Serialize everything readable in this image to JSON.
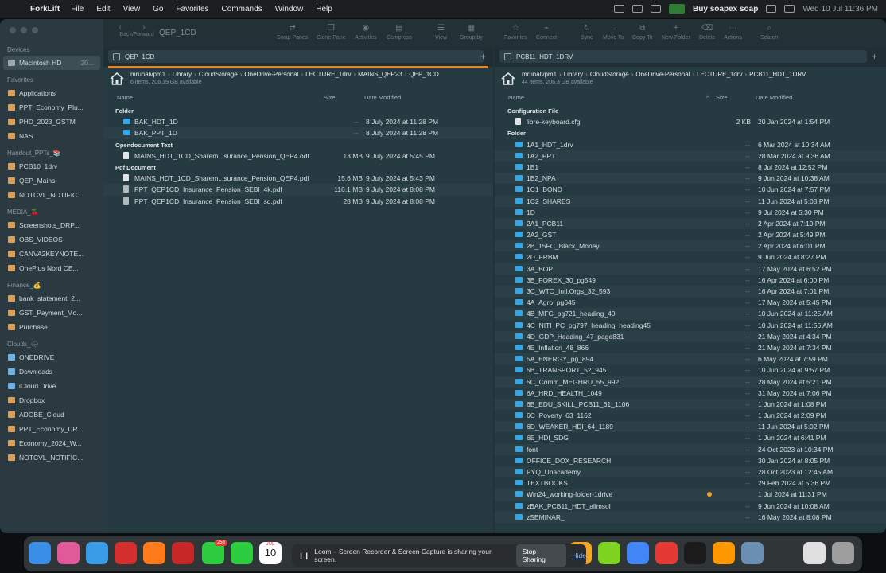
{
  "menubar": {
    "app_name": "ForkLift",
    "items": [
      "File",
      "Edit",
      "View",
      "Go",
      "Favorites",
      "Commands",
      "Window",
      "Help"
    ],
    "notification": "Buy soapex soap",
    "clock": "Wed 10 Jul  11:36 PM"
  },
  "toolbar": {
    "nav_label": "Back/Forward",
    "title": "QEP_1CD",
    "buttons": [
      "Swap Panes",
      "Clone Pane",
      "Activities",
      "Compress",
      "View",
      "Group by",
      "Favorites",
      "Connect",
      "Sync",
      "Move To",
      "Copy To",
      "New Folder",
      "Delete",
      "Actions",
      "Search"
    ]
  },
  "sidebar": {
    "sections": [
      {
        "title": "Devices",
        "items": [
          {
            "label": "Macintosh HD",
            "extra": "20...",
            "icon": "hard-drive-icon",
            "selected": true
          }
        ]
      },
      {
        "title": "Favorites",
        "items": [
          {
            "label": "Applications",
            "icon": "applications-icon"
          },
          {
            "label": "PPT_Economy_Plu...",
            "icon": "folder-icon"
          },
          {
            "label": "PHD_2023_GSTM",
            "icon": "folder-icon"
          },
          {
            "label": "NAS",
            "icon": "folder-icon"
          }
        ]
      },
      {
        "title": "Handout_PPTs_📚",
        "items": [
          {
            "label": "PCB10_1drv",
            "icon": "folder-icon"
          },
          {
            "label": "QEP_Mains",
            "icon": "folder-icon"
          },
          {
            "label": "NOTCVL_NOTIFIC...",
            "icon": "folder-icon"
          }
        ]
      },
      {
        "title": "MEDIA_🍒",
        "items": [
          {
            "label": "Screenshots_DRP...",
            "icon": "folder-icon"
          },
          {
            "label": "OBS_VIDEOS",
            "icon": "folder-icon"
          },
          {
            "label": "CANVA2KEYNOTE...",
            "icon": "folder-icon"
          },
          {
            "label": "OnePlus Nord CE...",
            "icon": "folder-icon"
          }
        ]
      },
      {
        "title": "Finance_💰",
        "items": [
          {
            "label": "bank_statement_2...",
            "icon": "folder-icon"
          },
          {
            "label": "GST_Payment_Mo...",
            "icon": "folder-icon"
          },
          {
            "label": "Purchase",
            "icon": "folder-icon"
          }
        ]
      },
      {
        "title": "Clouds_🌧",
        "items": [
          {
            "label": "ONEDRIVE",
            "icon": "cloud-icon"
          },
          {
            "label": "Downloads",
            "icon": "downloads-icon"
          },
          {
            "label": "iCloud Drive",
            "icon": "cloud-icon"
          },
          {
            "label": "Dropbox",
            "icon": "folder-icon"
          },
          {
            "label": "ADOBE_Cloud",
            "icon": "folder-icon"
          },
          {
            "label": "PPT_Economy_DR...",
            "icon": "folder-icon"
          },
          {
            "label": "Economy_2024_W...",
            "icon": "folder-icon"
          },
          {
            "label": "NOTCVL_NOTIFIC...",
            "icon": "folder-icon"
          }
        ]
      }
    ]
  },
  "left_pane": {
    "tab": "QEP_1CD",
    "path": [
      "mrunalvpm1",
      "Library",
      "CloudStorage",
      "OneDrive-Personal",
      "LECTURE_1drv",
      "MAINS_QEP23",
      "QEP_1CD"
    ],
    "summary": "6 items, 206.19 GB available",
    "columns": {
      "name": "Name",
      "size": "Size",
      "date": "Date Modified"
    },
    "groups": [
      {
        "title": "Folder",
        "rows": [
          {
            "name": "BAK_HDT_1D",
            "size": "--",
            "date": "8 July 2024 at 11:28 PM",
            "kind": "folder"
          },
          {
            "name": "BAK_PPT_1D",
            "size": "--",
            "date": "8 July 2024 at 11:28 PM",
            "kind": "folder"
          }
        ]
      },
      {
        "title": "Opendocument Text",
        "rows": [
          {
            "name": "MAINS_HDT_1CD_Sharem...surance_Pension_QEP4.odt",
            "size": "13 MB",
            "date": "9 July 2024 at 5:45 PM",
            "kind": "doc"
          }
        ]
      },
      {
        "title": "Pdf Document",
        "rows": [
          {
            "name": "MAINS_HDT_1CD_Sharem...surance_Pension_QEP4.pdf",
            "size": "15.6 MB",
            "date": "9 July 2024 at 5:43 PM",
            "kind": "doc"
          },
          {
            "name": "PPT_QEP1CD_Insurance_Pension_SEBI_4k.pdf",
            "size": "116.1 MB",
            "date": "9 July 2024 at 8:08 PM",
            "kind": "img"
          },
          {
            "name": "PPT_QEP1CD_Insurance_Pension_SEBI_sd.pdf",
            "size": "28 MB",
            "date": "9 July 2024 at 8:08 PM",
            "kind": "img"
          }
        ]
      }
    ]
  },
  "right_pane": {
    "tab": "PCB11_HDT_1DRV",
    "path": [
      "mrunalvpm1",
      "Library",
      "CloudStorage",
      "OneDrive-Personal",
      "LECTURE_1drv",
      "PCB11_HDT_1DRV"
    ],
    "summary": "44 items, 206.3 GB available",
    "columns": {
      "name": "Name",
      "size": "Size",
      "date": "Date Modified"
    },
    "groups": [
      {
        "title": "Configuration File",
        "rows": [
          {
            "name": "libre-keyboard.cfg",
            "size": "2 KB",
            "date": "20 Jan 2024 at 1:54 PM",
            "kind": "doc"
          }
        ]
      },
      {
        "title": "Folder",
        "rows": [
          {
            "name": "1A1_HDT_1drv",
            "size": "--",
            "date": "6 Mar 2024 at 10:34 AM",
            "kind": "folder"
          },
          {
            "name": "1A2_PPT",
            "size": "--",
            "date": "28 Mar 2024 at 9:36 AM",
            "kind": "folder"
          },
          {
            "name": "1B1",
            "size": "--",
            "date": "8 Jul 2024 at 12:52 PM",
            "kind": "folder"
          },
          {
            "name": "1B2_NPA",
            "size": "--",
            "date": "9 Jun 2024 at 10:38 AM",
            "kind": "folder"
          },
          {
            "name": "1C1_BOND",
            "size": "--",
            "date": "10 Jun 2024 at 7:57 PM",
            "kind": "folder"
          },
          {
            "name": "1C2_SHARES",
            "size": "--",
            "date": "11 Jun 2024 at 5:08 PM",
            "kind": "folder"
          },
          {
            "name": "1D",
            "size": "--",
            "date": "9 Jul 2024 at 5:30 PM",
            "kind": "folder"
          },
          {
            "name": "2A1_PCB11",
            "size": "--",
            "date": "2 Apr 2024 at 7:19 PM",
            "kind": "folder"
          },
          {
            "name": "2A2_GST",
            "size": "--",
            "date": "2 Apr 2024 at 5:49 PM",
            "kind": "folder"
          },
          {
            "name": "2B_15FC_Black_Money",
            "size": "--",
            "date": "2 Apr 2024 at 6:01 PM",
            "kind": "folder"
          },
          {
            "name": "2D_FRBM",
            "size": "--",
            "date": "9 Jun 2024 at 8:27 PM",
            "kind": "folder"
          },
          {
            "name": "3A_BOP",
            "size": "--",
            "date": "17 May 2024 at 6:52 PM",
            "kind": "folder"
          },
          {
            "name": "3B_FOREX_30_pg549",
            "size": "--",
            "date": "16 Apr 2024 at 6:00 PM",
            "kind": "folder"
          },
          {
            "name": "3C_WTO_Intl.Orgs_32_593",
            "size": "--",
            "date": "16 Apr 2024 at 7:01 PM",
            "kind": "folder"
          },
          {
            "name": "4A_Agro_pg645",
            "size": "--",
            "date": "17 May 2024 at 5:45 PM",
            "kind": "folder"
          },
          {
            "name": "4B_MFG_pg721_heading_40",
            "size": "--",
            "date": "10 Jun 2024 at 11:25 AM",
            "kind": "folder"
          },
          {
            "name": "4C_NITI_PC_pg797_heading_heading45",
            "size": "--",
            "date": "10 Jun 2024 at 11:56 AM",
            "kind": "folder"
          },
          {
            "name": "4D_GDP_Heading_47_page831",
            "size": "--",
            "date": "21 May 2024 at 4:34 PM",
            "kind": "folder"
          },
          {
            "name": "4E_Inflation_48_866",
            "size": "--",
            "date": "21 May 2024 at 7:34 PM",
            "kind": "folder"
          },
          {
            "name": "5A_ENERGY_pg_894",
            "size": "--",
            "date": "6 May 2024 at 7:59 PM",
            "kind": "folder"
          },
          {
            "name": "5B_TRANSPORT_52_945",
            "size": "--",
            "date": "10 Jun 2024 at 9:57 PM",
            "kind": "folder"
          },
          {
            "name": "5C_Comm_MEGHRU_55_992",
            "size": "--",
            "date": "28 May 2024 at 5:21 PM",
            "kind": "folder"
          },
          {
            "name": "6A_HRD_HEALTH_1049",
            "size": "--",
            "date": "31 May 2024 at 7:06 PM",
            "kind": "folder"
          },
          {
            "name": "6B_EDU_SKILL_PCB11_61_1106",
            "size": "--",
            "date": "1 Jun 2024 at 1:08 PM",
            "kind": "folder"
          },
          {
            "name": "6C_Poverty_63_1162",
            "size": "--",
            "date": "1 Jun 2024 at 2:09 PM",
            "kind": "folder"
          },
          {
            "name": "6D_WEAKER_HDI_64_1189",
            "size": "--",
            "date": "11 Jun 2024 at 5:02 PM",
            "kind": "folder"
          },
          {
            "name": "6E_HDI_SDG",
            "size": "--",
            "date": "1 Jun 2024 at 6:41 PM",
            "kind": "folder"
          },
          {
            "name": "font",
            "size": "--",
            "date": "24 Oct 2023 at 10:34 PM",
            "kind": "folder"
          },
          {
            "name": "OFFICE_DOX_RESEARCH",
            "size": "--",
            "date": "30 Jan 2024 at 8:05 PM",
            "kind": "folder"
          },
          {
            "name": "PYQ_Unacademy",
            "size": "--",
            "date": "28 Oct 2023 at 12:45 AM",
            "kind": "folder"
          },
          {
            "name": "TEXTBOOKS",
            "size": "--",
            "date": "29 Feb 2024 at 5:36 PM",
            "kind": "folder"
          },
          {
            "name": "Win24_working-folder-1drive",
            "size": "",
            "date": "1 Jul 2024 at 11:31 PM",
            "kind": "folder",
            "tag": true
          },
          {
            "name": "zBAK_PCB11_HDT_allmsol",
            "size": "--",
            "date": "9 Jun 2024 at 10:08 AM",
            "kind": "folder"
          },
          {
            "name": "zSEMINAR_",
            "size": "--",
            "date": "16 May 2024 at 8:08 PM",
            "kind": "folder"
          }
        ]
      }
    ]
  },
  "dock": {
    "calendar_month": "JUL",
    "calendar_day": "10",
    "messages_badge": "258",
    "colors": [
      "#3a8ee6",
      "#e05a9a",
      "#3a9be6",
      "#d32f2f",
      "#ff7a1a",
      "#c62828",
      "#2ecc40",
      "#2ecc40",
      "#ffffff"
    ],
    "right_colors": [
      "#f5a623",
      "#7ed321",
      "#4285f4",
      "#e53935",
      "#1b1b1b",
      "#ff9800",
      "#6b8fb3",
      "#e0e0e0",
      "#9e9e9e"
    ]
  },
  "loom": {
    "message": "Loom – Screen Recorder & Screen Capture is sharing your screen.",
    "stop": "Stop Sharing",
    "hide": "Hide"
  },
  "colors": {
    "folder": "#35a6e6",
    "accent_orange": "#e3832a",
    "window_bg": "#243238",
    "sidebar_bg": "#2b3a41"
  }
}
